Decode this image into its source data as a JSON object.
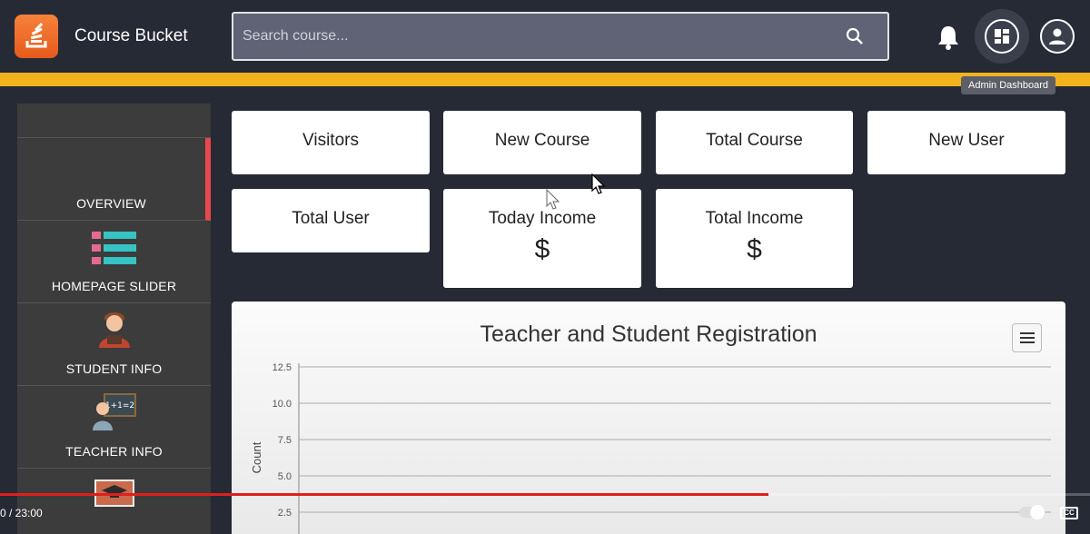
{
  "app": {
    "brand": "Course Bucket"
  },
  "search": {
    "placeholder": "Search course..."
  },
  "header": {
    "dashboard_tooltip": "Admin Dashboard"
  },
  "sidebar": {
    "items": [
      {
        "label": "OVERVIEW",
        "icon": "overview"
      },
      {
        "label": "HOMEPAGE SLIDER",
        "icon": "slider-list-icon"
      },
      {
        "label": "STUDENT INFO",
        "icon": "student-icon"
      },
      {
        "label": "TEACHER INFO",
        "icon": "teacher-icon"
      },
      {
        "label": "",
        "icon": "graduation-cap-icon"
      }
    ]
  },
  "cards": [
    {
      "label": "Visitors",
      "value": ""
    },
    {
      "label": "New Course",
      "value": ""
    },
    {
      "label": "Total Course",
      "value": ""
    },
    {
      "label": "New User",
      "value": ""
    },
    {
      "label": "Total User",
      "value": ""
    },
    {
      "label": "Today Income",
      "value": "$"
    },
    {
      "label": "Total Income",
      "value": "$"
    }
  ],
  "chart_data": {
    "type": "line",
    "title": "Teacher and Student Registration",
    "ylabel": "Count",
    "xlabel": "",
    "ylim": [
      0,
      12.5
    ],
    "yticks": [
      "12.5",
      "10.0",
      "7.5",
      "5.0",
      "2.5"
    ],
    "series": []
  },
  "video": {
    "time": "0 / 23:00",
    "progress": 0.705,
    "buffered": 0.79
  },
  "colors": {
    "accent": "#f2b21e",
    "active_marker": "#e8484b",
    "progress": "#e01e1e"
  }
}
